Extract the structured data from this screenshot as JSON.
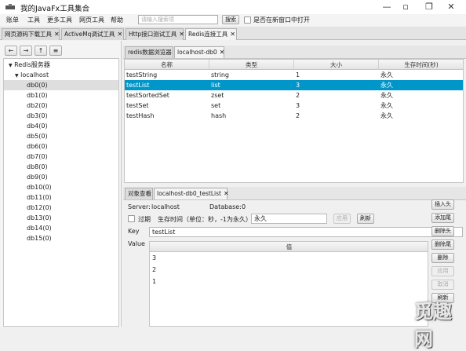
{
  "window": {
    "title": "我的JavaFx工具集合"
  },
  "menubar": {
    "items": [
      {
        "label": "账单"
      },
      {
        "label": "工具"
      },
      {
        "label": "更多工具"
      },
      {
        "label": "网页工具"
      },
      {
        "label": "帮助"
      }
    ],
    "search_placeholder": "请输入搜索项",
    "search_button": "搜索",
    "new_window_label": "是否在新窗口中打开"
  },
  "top_tabs": [
    {
      "label": "网页源码下载工具"
    },
    {
      "label": "ActiveMq调试工具"
    },
    {
      "label": "Http接口测试工具"
    },
    {
      "label": "Redis连接工具"
    }
  ],
  "left": {
    "nav": [
      {
        "label": "←"
      },
      {
        "label": "→"
      },
      {
        "label": "↑"
      },
      {
        "label": "≡"
      }
    ],
    "tree": {
      "root": "Redis服务器",
      "host": "localhost",
      "dbs": [
        "db0(0)",
        "db1(0)",
        "db2(0)",
        "db3(0)",
        "db4(0)",
        "db5(0)",
        "db6(0)",
        "db7(0)",
        "db8(0)",
        "db9(0)",
        "db10(0)",
        "db11(0)",
        "db12(0)",
        "db13(0)",
        "db14(0)",
        "db15(0)"
      ],
      "selected_index": 0
    }
  },
  "browser_tabs": [
    {
      "label": "redis数据浏览器"
    },
    {
      "label": "localhost-db0"
    }
  ],
  "keys_table": {
    "headers": [
      "名称",
      "类型",
      "大小",
      "生存时间(秒)"
    ],
    "rows": [
      {
        "name": "testString",
        "type": "string",
        "size": "1",
        "ttl": "永久"
      },
      {
        "name": "testList",
        "type": "list",
        "size": "3",
        "ttl": "永久"
      },
      {
        "name": "testSortedSet",
        "type": "zset",
        "size": "2",
        "ttl": "永久"
      },
      {
        "name": "testSet",
        "type": "set",
        "size": "3",
        "ttl": "永久"
      },
      {
        "name": "testHash",
        "type": "hash",
        "size": "2",
        "ttl": "永久"
      }
    ],
    "selected_index": 1
  },
  "detail_tabs": [
    {
      "label": "对象查看"
    },
    {
      "label": "localhost-db0_testList"
    }
  ],
  "detail": {
    "server_label": "Server:",
    "server_value": "localhost",
    "database_label": "Database:",
    "database_value": "0",
    "expire_label": "过期",
    "ttl_label": "生存时间（单位：秒，-1为永久）",
    "ttl_value": "永久",
    "apply_button": "应用",
    "refresh_button": "刷新",
    "key_label": "Key",
    "key_value": "testList",
    "value_label": "Value",
    "value_header": "值",
    "values": [
      "3",
      "2",
      "1"
    ],
    "buttons": [
      {
        "label": "插入头",
        "disabled": false
      },
      {
        "label": "添加尾",
        "disabled": false
      },
      {
        "label": "删除头",
        "disabled": false
      },
      {
        "label": "删除尾",
        "disabled": false
      },
      {
        "label": "删除",
        "disabled": false
      },
      {
        "label": "应用",
        "disabled": true
      },
      {
        "label": "取消",
        "disabled": true
      },
      {
        "label": "刷新",
        "disabled": false
      }
    ]
  },
  "watermark": "觅趣网",
  "colors": {
    "selection": "#0096c9",
    "tree_selection": "#dedede"
  }
}
